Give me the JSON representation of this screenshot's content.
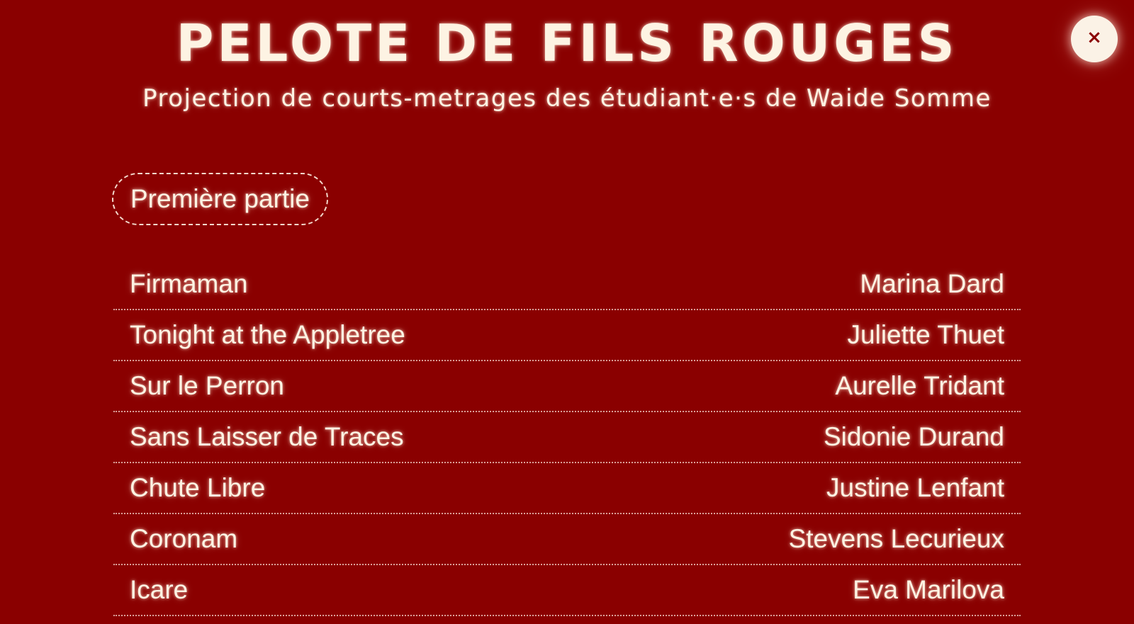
{
  "header": {
    "title": "PELOTE DE FILS ROUGES",
    "subtitle": "Projection de courts-metrages des étudiant·e·s de Waide Somme"
  },
  "close_button": {
    "label": "×",
    "icon": "close-icon"
  },
  "section": {
    "label": "Première partie"
  },
  "films": [
    {
      "title": "Firmaman",
      "author": "Marina Dard"
    },
    {
      "title": "Tonight at the Appletree",
      "author": "Juliette Thuet"
    },
    {
      "title": "Sur le Perron",
      "author": "Aurelle Tridant"
    },
    {
      "title": "Sans Laisser de Traces",
      "author": "Sidonie Durand"
    },
    {
      "title": "Chute Libre",
      "author": "Justine Lenfant"
    },
    {
      "title": "Coronam",
      "author": "Stevens Lecurieux"
    },
    {
      "title": "Icare",
      "author": "Eva Marilova"
    }
  ],
  "colors": {
    "background": "#8a0000",
    "text": "#fdf3e3",
    "close_button_bg": "#fbf2e6"
  }
}
